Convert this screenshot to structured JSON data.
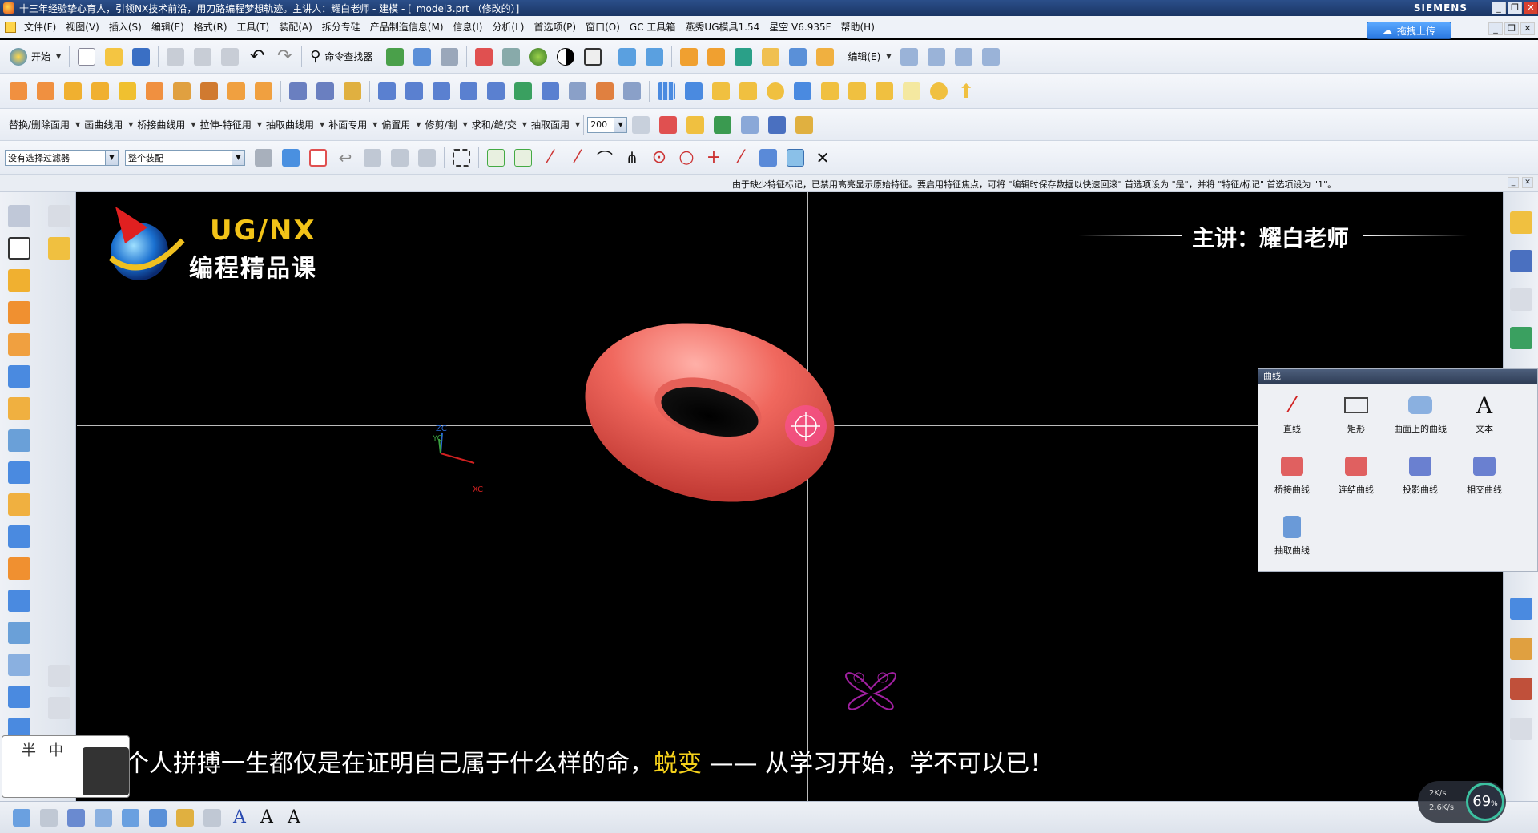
{
  "window": {
    "title": "十三年经验挚心育人，引领NX技术前沿，用刀路编程梦想轨迹。主讲人：耀白老师 - 建模 - [_model3.prt （修改的）]",
    "brand": "SIEMENS"
  },
  "menubar": {
    "items": [
      "文件(F)",
      "视图(V)",
      "插入(S)",
      "编辑(E)",
      "格式(R)",
      "工具(T)",
      "装配(A)",
      "拆分专硅",
      "产品制造信息(M)",
      "信息(I)",
      "分析(L)",
      "首选项(P)",
      "窗口(O)",
      "GC 工具箱",
      "燕秀UG模具1.54",
      "星空 V6.935F",
      "帮助(H)"
    ],
    "cloud_button": "拖拽上传"
  },
  "toolbar1": {
    "start_label": "开始",
    "command_finder": "命令查找器",
    "edit_label": "编辑(E)"
  },
  "toolbar3": {
    "items": [
      "替换/删除面用",
      "画曲线用",
      "桥接曲线用",
      "拉伸-特征用",
      "抽取曲线用",
      "补面专用",
      "偏置用",
      "修剪/割",
      "求和/缝/交",
      "抽取面用"
    ],
    "zoom_value": "200"
  },
  "toolbar4": {
    "filter_value": "没有选择过滤器",
    "scope_value": "整个装配"
  },
  "status_message": "由于缺少特征标记，已禁用高亮显示原始特征。要启用特征焦点，可将 \"编辑时保存数据以快速回滚\" 首选项设为 \"是\"，并将 \"特征/标记\" 首选项设为 \"1\"。",
  "viewport": {
    "logo_line1": "UG/NX",
    "logo_line2": "编程精品课",
    "teacher": "主讲：耀白老师",
    "subtitle_pre": "个人拼搏一生都仅是在证明自己属于什么样的命，",
    "subtitle_highlight": "蜕变",
    "subtitle_post": " —— 从学习开始，学不可以已！",
    "axis_labels": {
      "zc": "ZC",
      "yc": "YC",
      "xc": "XC"
    },
    "torus_color": "#f0685e"
  },
  "curve_panel": {
    "title": "曲线",
    "items": [
      "直线",
      "矩形",
      "曲面上的曲线",
      "文本",
      "桥接曲线",
      "连结曲线",
      "投影曲线",
      "相交曲线",
      "抽取曲线"
    ]
  },
  "ime": {
    "half": "半",
    "cn": "中"
  },
  "speed": {
    "up": "2K/s",
    "down": "2.6K/s",
    "percent": "69"
  }
}
